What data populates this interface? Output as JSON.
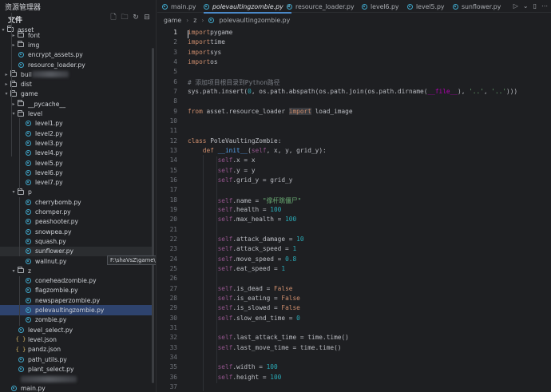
{
  "sidebar": {
    "title": "资源管理器",
    "section": "文件",
    "tooltip": "F:\\shaVsZ\\game\\p\\sunflower.py",
    "rows": [
      {
        "label": "font",
        "type": "folder",
        "depth": 1,
        "open": false
      },
      {
        "label": "img",
        "type": "folder",
        "depth": 1,
        "open": false
      },
      {
        "label": "encrypt_assets.py",
        "type": "py",
        "depth": 1
      },
      {
        "label": "resource_loader.py",
        "type": "py",
        "depth": 1
      },
      {
        "label": "buil",
        "type": "folder",
        "depth": 0,
        "open": false,
        "blur": true
      },
      {
        "label": "dist",
        "type": "folder",
        "depth": 0,
        "open": false
      },
      {
        "label": "game",
        "type": "folder",
        "depth": 0,
        "open": true
      },
      {
        "label": "__pycache__",
        "type": "folder",
        "depth": 1,
        "open": false
      },
      {
        "label": "level",
        "type": "folder",
        "depth": 1,
        "open": true
      },
      {
        "label": "level1.py",
        "type": "py",
        "depth": 2
      },
      {
        "label": "level2.py",
        "type": "py",
        "depth": 2
      },
      {
        "label": "level3.py",
        "type": "py",
        "depth": 2
      },
      {
        "label": "level4.py",
        "type": "py",
        "depth": 2
      },
      {
        "label": "level5.py",
        "type": "py",
        "depth": 2
      },
      {
        "label": "level6.py",
        "type": "py",
        "depth": 2
      },
      {
        "label": "level7.py",
        "type": "py",
        "depth": 2
      },
      {
        "label": "p",
        "type": "folder",
        "depth": 1,
        "open": true
      },
      {
        "label": "cherrybomb.py",
        "type": "py",
        "depth": 2
      },
      {
        "label": "chomper.py",
        "type": "py",
        "depth": 2
      },
      {
        "label": "peashooter.py",
        "type": "py",
        "depth": 2
      },
      {
        "label": "snowpea.py",
        "type": "py",
        "depth": 2
      },
      {
        "label": "squash.py",
        "type": "py",
        "depth": 2
      },
      {
        "label": "sunflower.py",
        "type": "py",
        "depth": 2,
        "hover": true
      },
      {
        "label": "wallnut.py",
        "type": "py",
        "depth": 2
      },
      {
        "label": "z",
        "type": "folder",
        "depth": 1,
        "open": true
      },
      {
        "label": "coneheadzombie.py",
        "type": "py",
        "depth": 2
      },
      {
        "label": "flagzombie.py",
        "type": "py",
        "depth": 2
      },
      {
        "label": "newspaperzombie.py",
        "type": "py",
        "depth": 2
      },
      {
        "label": "polevaultingzombie.py",
        "type": "py",
        "depth": 2,
        "selected": true
      },
      {
        "label": "zombie.py",
        "type": "py",
        "depth": 2
      },
      {
        "label": "level_select.py",
        "type": "py",
        "depth": 1
      },
      {
        "label": "level.json",
        "type": "json",
        "depth": 1
      },
      {
        "label": "pandz.json",
        "type": "json",
        "depth": 1
      },
      {
        "label": "path_utils.py",
        "type": "py",
        "depth": 1
      },
      {
        "label": "plant_select.py",
        "type": "py",
        "depth": 1
      },
      {
        "label": "",
        "type": "blur",
        "depth": 0
      },
      {
        "label": "main.py",
        "type": "py",
        "depth": 0
      }
    ],
    "asset_label": "asset"
  },
  "tabs": [
    {
      "label": "main.py",
      "active": false
    },
    {
      "label": "polevaultingzombie.py",
      "active": true
    },
    {
      "label": "resource_loader.py",
      "active": false
    },
    {
      "label": "level6.py",
      "active": false
    },
    {
      "label": "level5.py",
      "active": false
    },
    {
      "label": "sunflower.py",
      "active": false
    }
  ],
  "breadcrumb": [
    "game",
    "z",
    "polevaultingzombie.py"
  ],
  "code": [
    [
      [
        "kw",
        "import"
      ],
      [
        "",
        "pygame"
      ]
    ],
    [
      [
        "kw",
        "import"
      ],
      [
        "",
        "time"
      ]
    ],
    [
      [
        "kw",
        "import"
      ],
      [
        "",
        "sys"
      ]
    ],
    [
      [
        "kw",
        "import"
      ],
      [
        "",
        "os"
      ]
    ],
    [],
    [
      [
        "cm",
        "# 添加项目根目录到Python路径"
      ]
    ],
    [
      [
        "",
        "sys.path.insert("
      ],
      [
        "num",
        "0"
      ],
      [
        "",
        ", os.path.abspath(os.path.join(os.path.dirname("
      ],
      [
        "mg",
        "__file__"
      ],
      [
        "",
        "), "
      ],
      [
        "str",
        "'..'"
      ],
      [
        "",
        ", "
      ],
      [
        "str",
        "'..'"
      ],
      [
        "",
        "))) "
      ]
    ],
    [],
    [
      [
        "kw",
        "from"
      ],
      [
        "",
        " asset.resource_loader "
      ],
      [
        "kw",
        "import"
      ],
      [
        "",
        " load_image"
      ]
    ],
    [],
    [],
    [
      [
        "kw",
        "class"
      ],
      [
        "",
        " "
      ],
      [
        "cls",
        "PoleVaultingZombie"
      ],
      [
        "",
        ":"
      ]
    ],
    [
      [
        "",
        "    "
      ],
      [
        "kw",
        "def"
      ],
      [
        "",
        " "
      ],
      [
        "fn",
        "__init__"
      ],
      [
        "",
        "("
      ],
      [
        "self",
        "self"
      ],
      [
        "",
        ", x, y, grid_y):"
      ]
    ],
    [
      [
        "",
        "        "
      ],
      [
        "self",
        "self"
      ],
      [
        "",
        ".x = x"
      ]
    ],
    [
      [
        "",
        "        "
      ],
      [
        "self",
        "self"
      ],
      [
        "",
        ".y = y"
      ]
    ],
    [
      [
        "",
        "        "
      ],
      [
        "self",
        "self"
      ],
      [
        "",
        ".grid_y = grid_y"
      ]
    ],
    [],
    [
      [
        "",
        "        "
      ],
      [
        "self",
        "self"
      ],
      [
        "",
        ".name = "
      ],
      [
        "str",
        "\"撑杆跳僵尸\""
      ]
    ],
    [
      [
        "",
        "        "
      ],
      [
        "self",
        "self"
      ],
      [
        "",
        ".health = "
      ],
      [
        "num",
        "100"
      ]
    ],
    [
      [
        "",
        "        "
      ],
      [
        "self",
        "self"
      ],
      [
        "",
        ".max_health = "
      ],
      [
        "num",
        "100"
      ]
    ],
    [],
    [
      [
        "",
        "        "
      ],
      [
        "self",
        "self"
      ],
      [
        "",
        ".attack_damage = "
      ],
      [
        "num",
        "10"
      ]
    ],
    [
      [
        "",
        "        "
      ],
      [
        "self",
        "self"
      ],
      [
        "",
        ".attack_speed = "
      ],
      [
        "num",
        "1"
      ]
    ],
    [
      [
        "",
        "        "
      ],
      [
        "self",
        "self"
      ],
      [
        "",
        ".move_speed = "
      ],
      [
        "num",
        "0.8"
      ]
    ],
    [
      [
        "",
        "        "
      ],
      [
        "self",
        "self"
      ],
      [
        "",
        ".eat_speed = "
      ],
      [
        "num",
        "1"
      ]
    ],
    [],
    [
      [
        "",
        "        "
      ],
      [
        "self",
        "self"
      ],
      [
        "",
        ".is_dead = "
      ],
      [
        "kw",
        "False"
      ]
    ],
    [
      [
        "",
        "        "
      ],
      [
        "self",
        "self"
      ],
      [
        "",
        ".is_eating = "
      ],
      [
        "kw",
        "False"
      ]
    ],
    [
      [
        "",
        "        "
      ],
      [
        "self",
        "self"
      ],
      [
        "",
        ".is_slowed = "
      ],
      [
        "kw",
        "False"
      ]
    ],
    [
      [
        "",
        "        "
      ],
      [
        "self",
        "self"
      ],
      [
        "",
        ".slow_end_time = "
      ],
      [
        "num",
        "0"
      ]
    ],
    [],
    [
      [
        "",
        "        "
      ],
      [
        "self",
        "self"
      ],
      [
        "",
        ".last_attack_time = time.time()"
      ]
    ],
    [
      [
        "",
        "        "
      ],
      [
        "self",
        "self"
      ],
      [
        "",
        ".last_move_time = time.time()"
      ]
    ],
    [],
    [
      [
        "",
        "        "
      ],
      [
        "self",
        "self"
      ],
      [
        "",
        ".width = "
      ],
      [
        "num",
        "100"
      ]
    ],
    [
      [
        "",
        "        "
      ],
      [
        "self",
        "self"
      ],
      [
        "",
        ".height = "
      ],
      [
        "num",
        "100"
      ]
    ],
    []
  ]
}
